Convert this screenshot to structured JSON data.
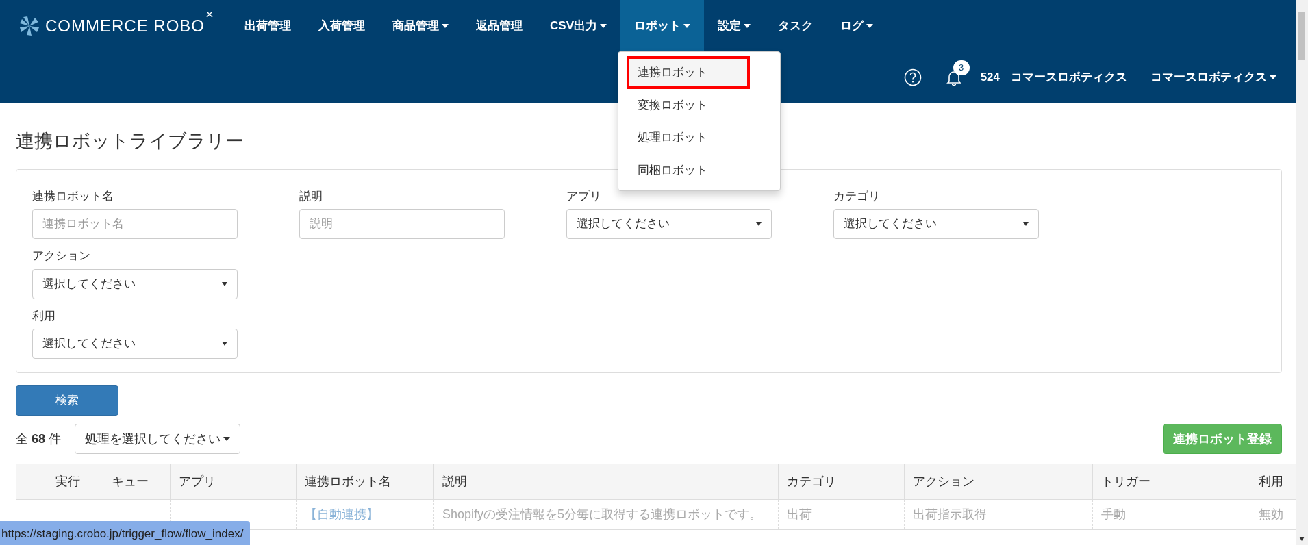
{
  "header": {
    "logo": "COMMERCE ROBO",
    "nav": [
      {
        "label": "出荷管理",
        "dropdown": false,
        "selected": false
      },
      {
        "label": "入荷管理",
        "dropdown": false,
        "selected": false
      },
      {
        "label": "商品管理",
        "dropdown": true,
        "selected": false
      },
      {
        "label": "返品管理",
        "dropdown": false,
        "selected": false
      },
      {
        "label": "CSV出力",
        "dropdown": true,
        "selected": false
      },
      {
        "label": "ロボット",
        "dropdown": true,
        "selected": true
      },
      {
        "label": "設定",
        "dropdown": true,
        "selected": false
      },
      {
        "label": "タスク",
        "dropdown": false,
        "selected": false
      },
      {
        "label": "ログ",
        "dropdown": true,
        "selected": false
      }
    ],
    "dropdown_menu": [
      {
        "label": "連携ロボット",
        "highlighted": true
      },
      {
        "label": "変換ロボット",
        "highlighted": false
      },
      {
        "label": "処理ロボット",
        "highlighted": false
      },
      {
        "label": "同梱ロボット",
        "highlighted": false
      }
    ],
    "notification_count": "3",
    "account_id": "524",
    "company": "コマースロボティクス",
    "user_menu": "コマースロボティクス"
  },
  "page_title": "連携ロボットライブラリー",
  "filters": [
    {
      "label": "連携ロボット名",
      "kind": "text",
      "placeholder": "連携ロボット名"
    },
    {
      "label": "説明",
      "kind": "text",
      "placeholder": "説明"
    },
    {
      "label": "アプリ",
      "kind": "select",
      "value": "選択してください"
    },
    {
      "label": "カテゴリ",
      "kind": "select",
      "value": "選択してください"
    },
    {
      "label": "アクション",
      "kind": "select",
      "value": "選択してください"
    },
    {
      "label": "利用",
      "kind": "select",
      "value": "選択してください"
    }
  ],
  "search_button": "検索",
  "count": "全 **68** 件",
  "bulk_action": "処理を選択してください",
  "register_button": "連携ロボット登録",
  "table": {
    "columns": [
      "実行",
      "キュー",
      "アプリ",
      "連携ロボット名",
      "説明",
      "カテゴリ",
      "アクション",
      "トリガー",
      "利用"
    ],
    "rows": [
      {
        "name": "【自動連携】",
        "description": "Shopifyの受注情報を5分毎に取得する連携ロボットです。",
        "category": "出荷",
        "action": "出荷指示取得",
        "trigger": "手動",
        "usage": "無効"
      }
    ]
  },
  "status_url": "https://staging.crobo.jp/trigger_flow/flow_index/"
}
